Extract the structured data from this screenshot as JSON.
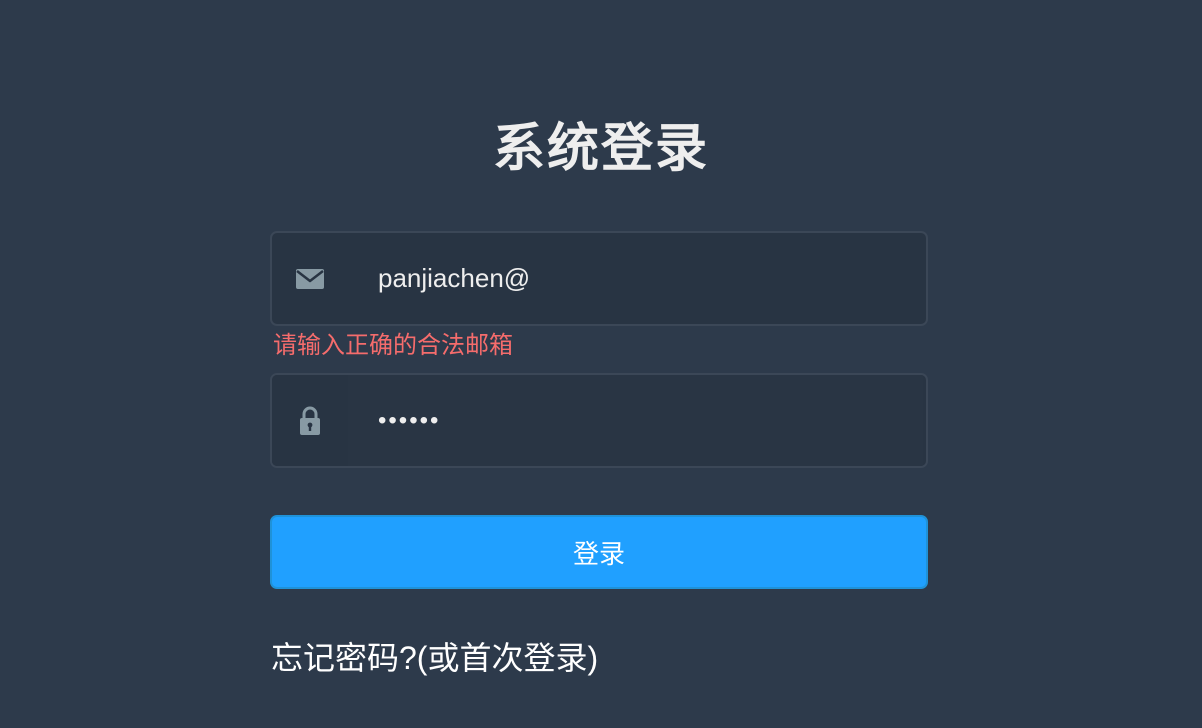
{
  "app": {
    "title": "系统登录"
  },
  "form": {
    "email": {
      "value": "panjiachen@",
      "icon": "email-icon",
      "error": "请输入正确的合法邮箱"
    },
    "password": {
      "value": "••••••",
      "icon": "lock-icon"
    },
    "login_label": "登录",
    "forgot_label": "忘记密码?(或首次登录)"
  },
  "colors": {
    "background": "#2d3a4b",
    "field_background": "#283443",
    "accent": "#20a0ff",
    "error": "#f56c6c",
    "icon": "#889aa4"
  }
}
